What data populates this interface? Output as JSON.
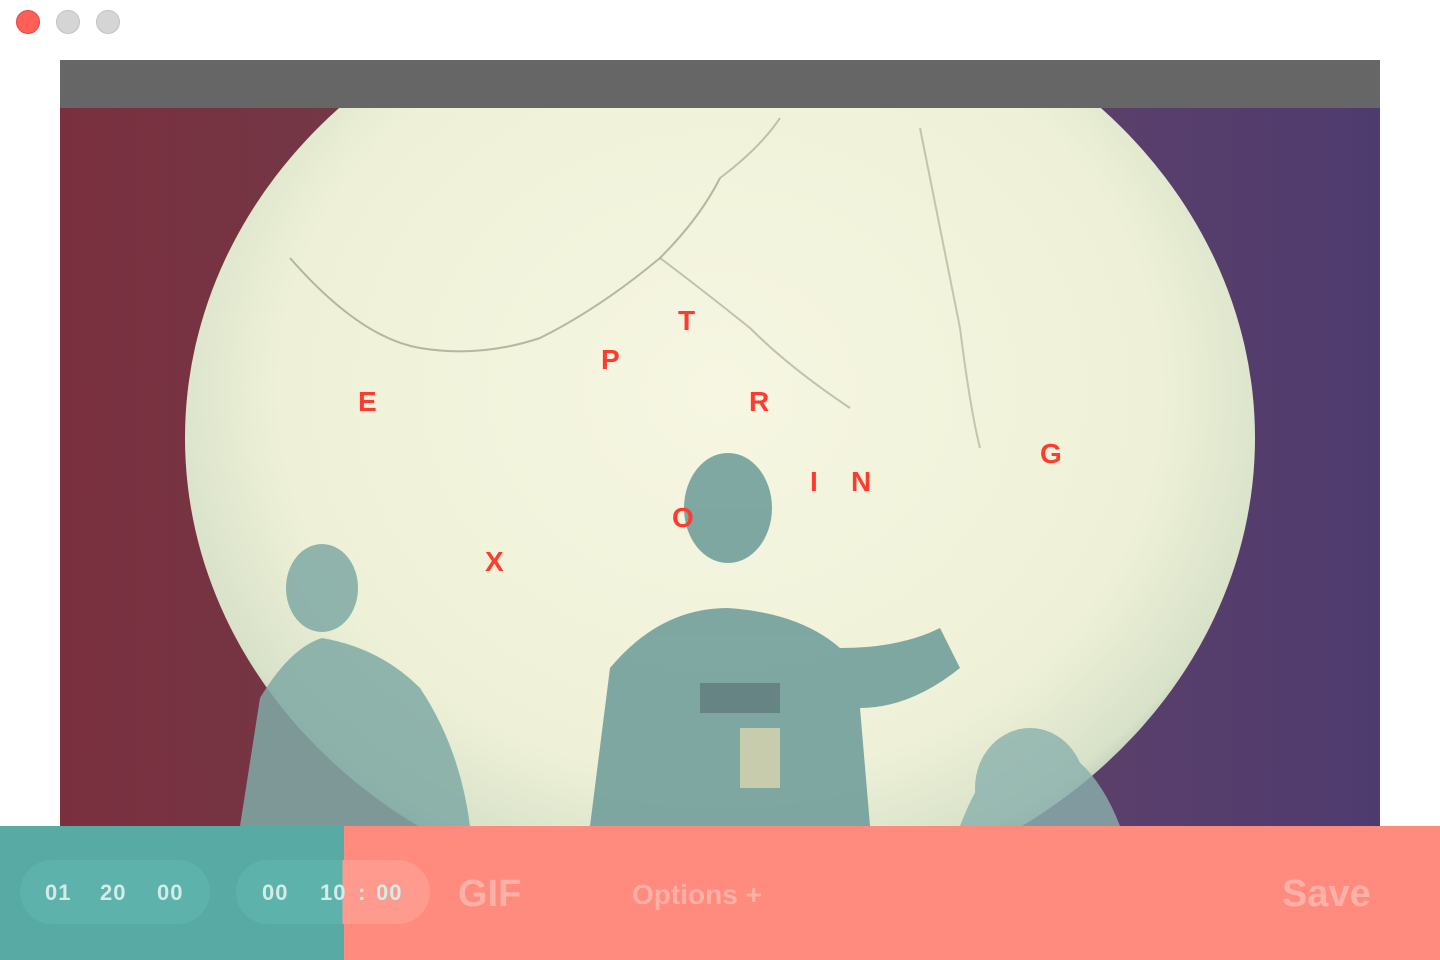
{
  "window": {
    "controls": [
      "close-button",
      "minimize-button",
      "zoom-button"
    ]
  },
  "overlay_letters": [
    {
      "char": "E"
    },
    {
      "char": "X"
    },
    {
      "char": "P"
    },
    {
      "char": "T"
    },
    {
      "char": "O"
    },
    {
      "char": "R"
    },
    {
      "char": "I"
    },
    {
      "char": "N"
    },
    {
      "char": "G"
    }
  ],
  "toolbar": {
    "start_time": {
      "hours": "01",
      "minutes": "20",
      "seconds": "00"
    },
    "duration": {
      "hours": "00",
      "minutes": "10",
      "separator": ":",
      "seconds": "00"
    },
    "format_label": "GIF",
    "options_label": "Options +",
    "save_label": "Save",
    "export_progress": 0.239
  },
  "colors": {
    "progress_fill": "#57aba4",
    "toolbar_bg": "#ff8a7e",
    "letter_color": "#ff3b2f"
  }
}
